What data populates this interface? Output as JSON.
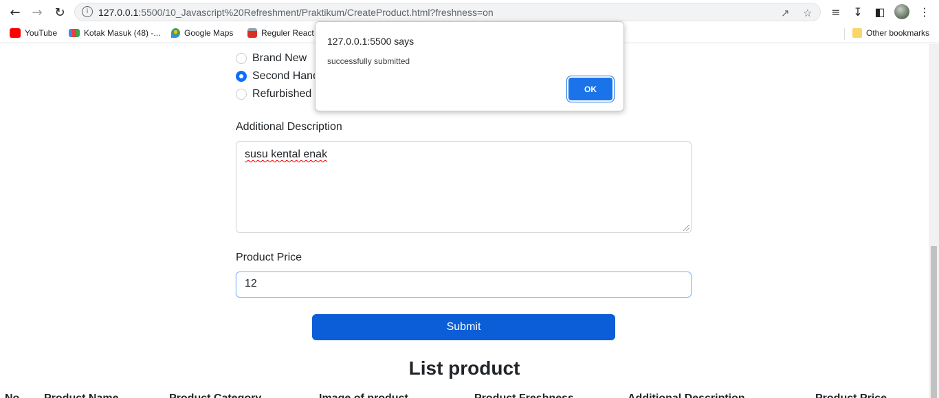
{
  "browser": {
    "url_host": "127.0.0.1",
    "url_rest": ":5500/10_Javascript%20Refreshment/Praktikum/CreateProduct.html?freshness=on",
    "bookmarks": [
      {
        "label": "YouTube",
        "color": "#ff0000"
      },
      {
        "label": "Kotak Masuk (48) -...",
        "color": "#ea4335"
      },
      {
        "label": "Google Maps",
        "color": "#34a853"
      },
      {
        "label": "Reguler React",
        "color": "#d93025"
      }
    ],
    "other_bookmarks": "Other bookmarks"
  },
  "form": {
    "freshness_options": [
      {
        "label": "Brand New",
        "checked": false
      },
      {
        "label": "Second Hand",
        "checked": true
      },
      {
        "label": "Refurbished",
        "checked": false
      }
    ],
    "description_label": "Additional Description",
    "description_value": "susu kental enak",
    "price_label": "Product Price",
    "price_value": "12",
    "submit_label": "Submit"
  },
  "list": {
    "title": "List product",
    "columns": [
      "No",
      "Product Name",
      "Product Category",
      "Image of product",
      "Product Freshness",
      "Additional Description",
      "Product Price"
    ]
  },
  "dialog": {
    "title": "127.0.0.1:5500 says",
    "message": "successfully submitted",
    "ok_label": "OK"
  }
}
